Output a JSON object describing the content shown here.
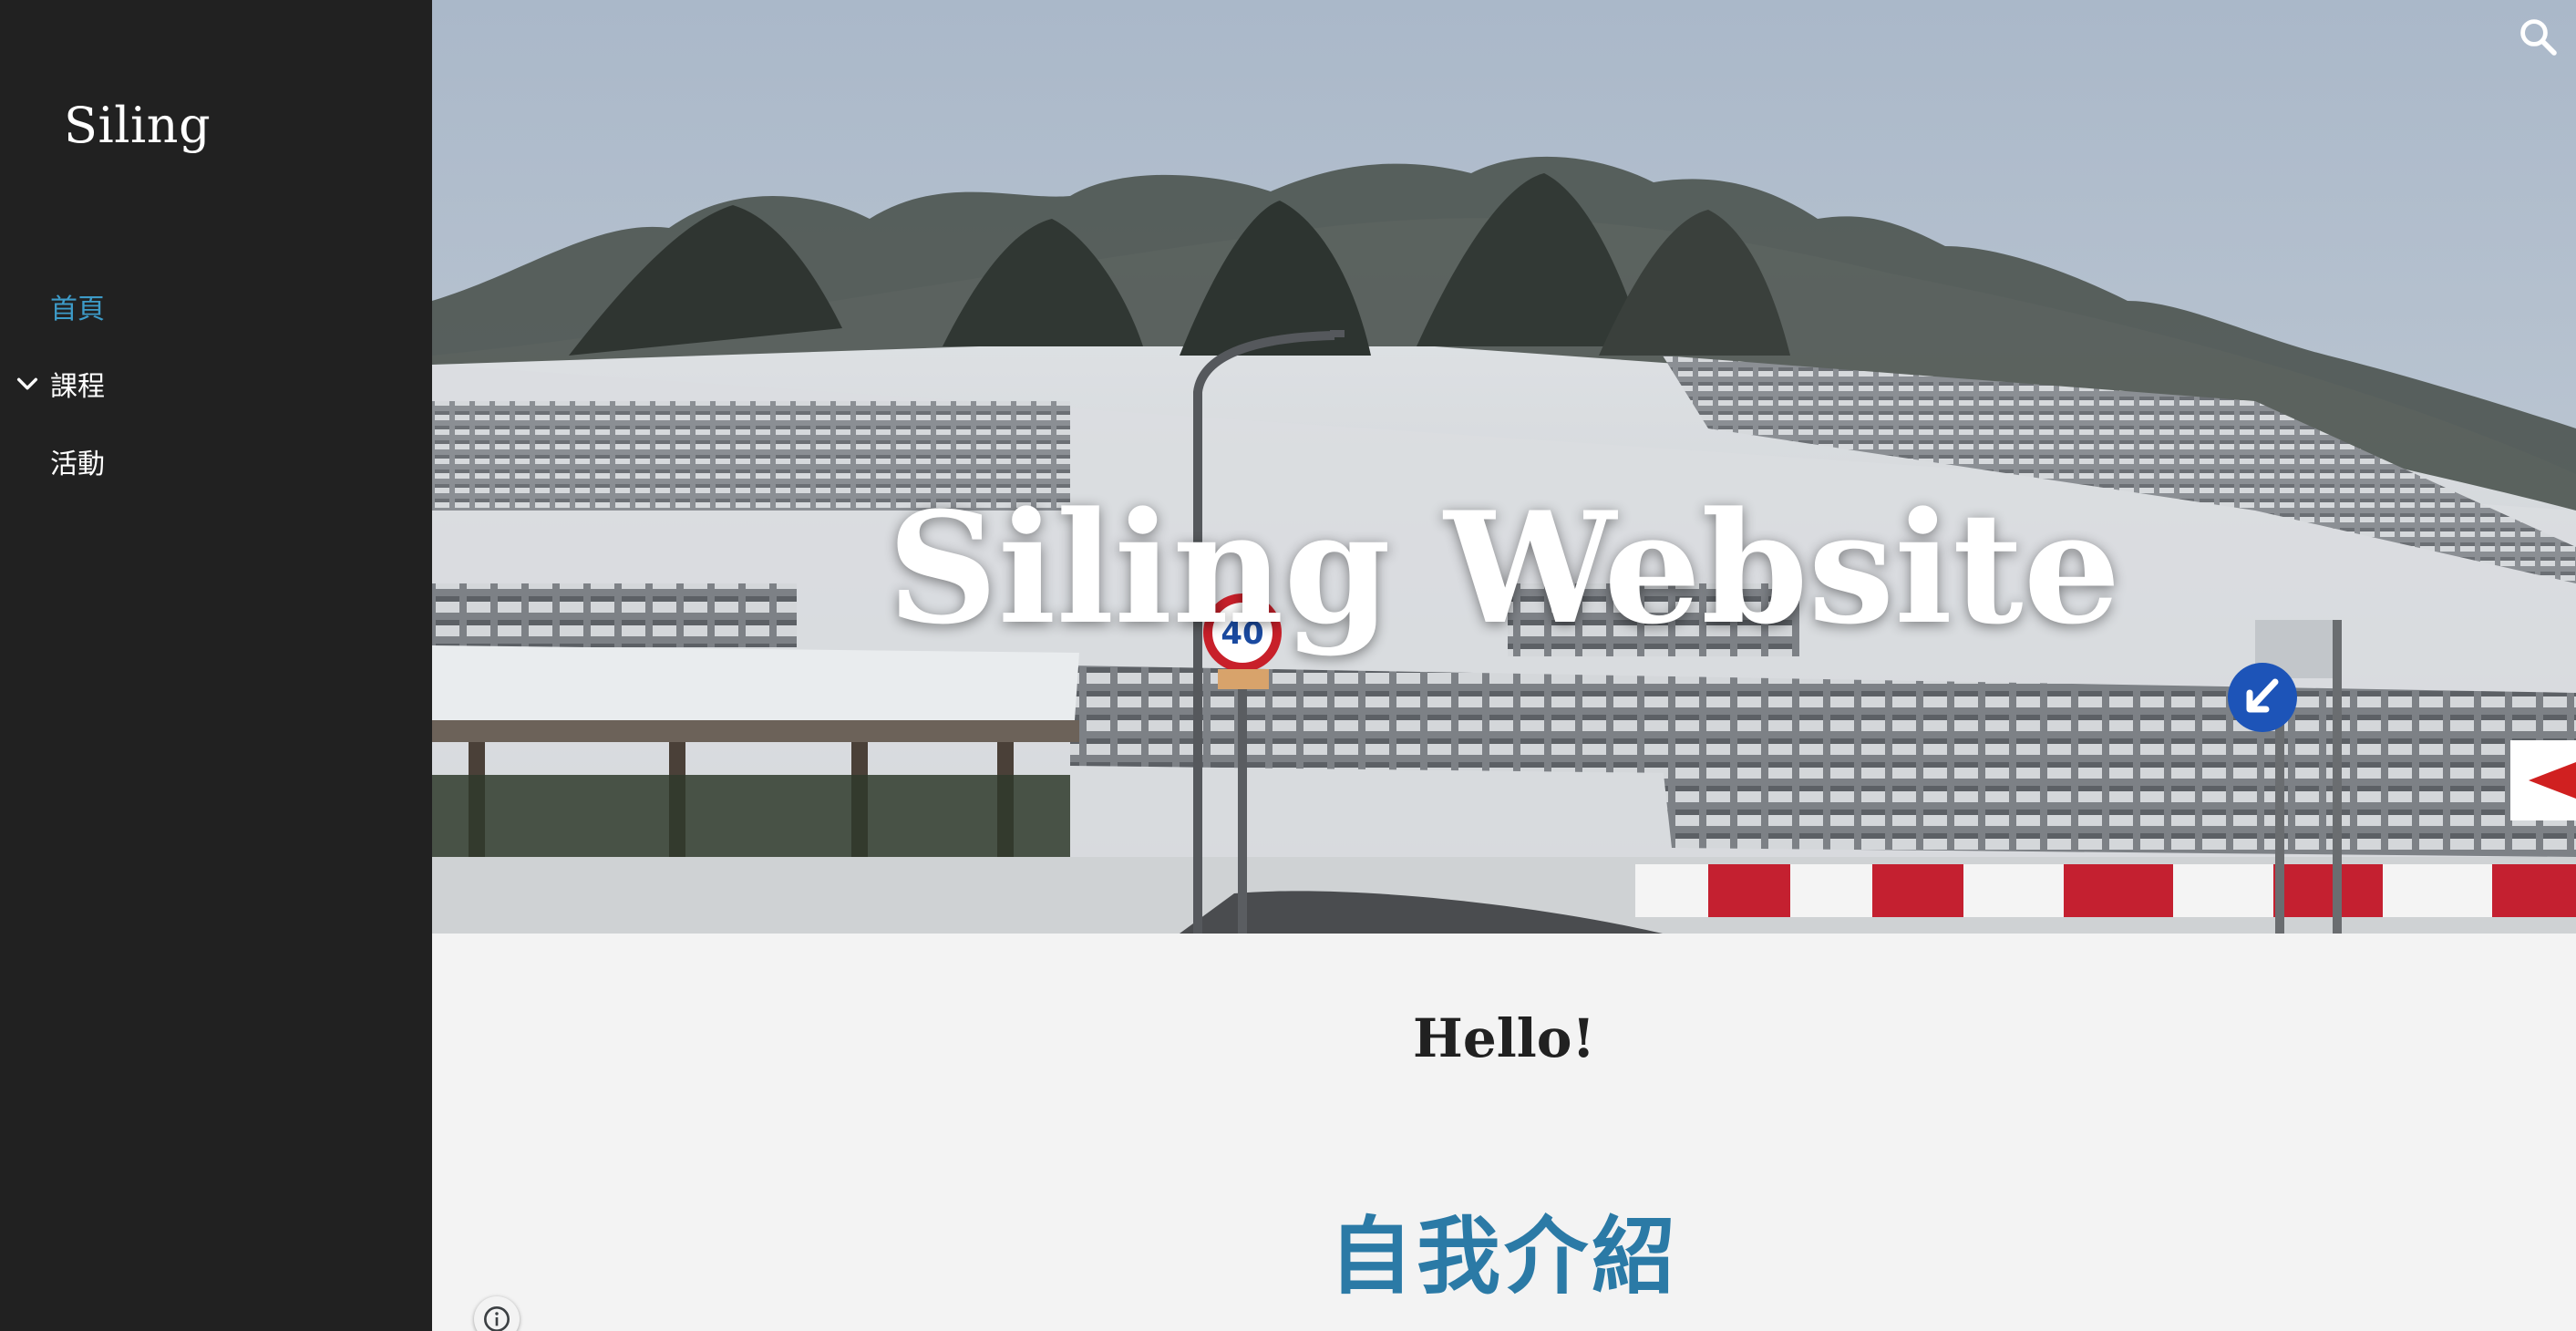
{
  "sidebar": {
    "site_name": "Siling",
    "nav": [
      {
        "label": "首頁",
        "active": true
      },
      {
        "label": "課程",
        "expandable": true
      },
      {
        "label": "活動"
      }
    ]
  },
  "hero": {
    "title": "Siling Website",
    "speed_sign": "40"
  },
  "content": {
    "greeting": "Hello!",
    "section_heading": "自我介紹"
  },
  "icons": {
    "search": "search-icon",
    "expand": "chevron-down-icon",
    "info": "info-icon"
  },
  "colors": {
    "sidebar_bg": "#212121",
    "active_nav": "#3d9bc8",
    "heading_accent": "#2b7aa6",
    "content_bg": "#f3f3f3"
  }
}
